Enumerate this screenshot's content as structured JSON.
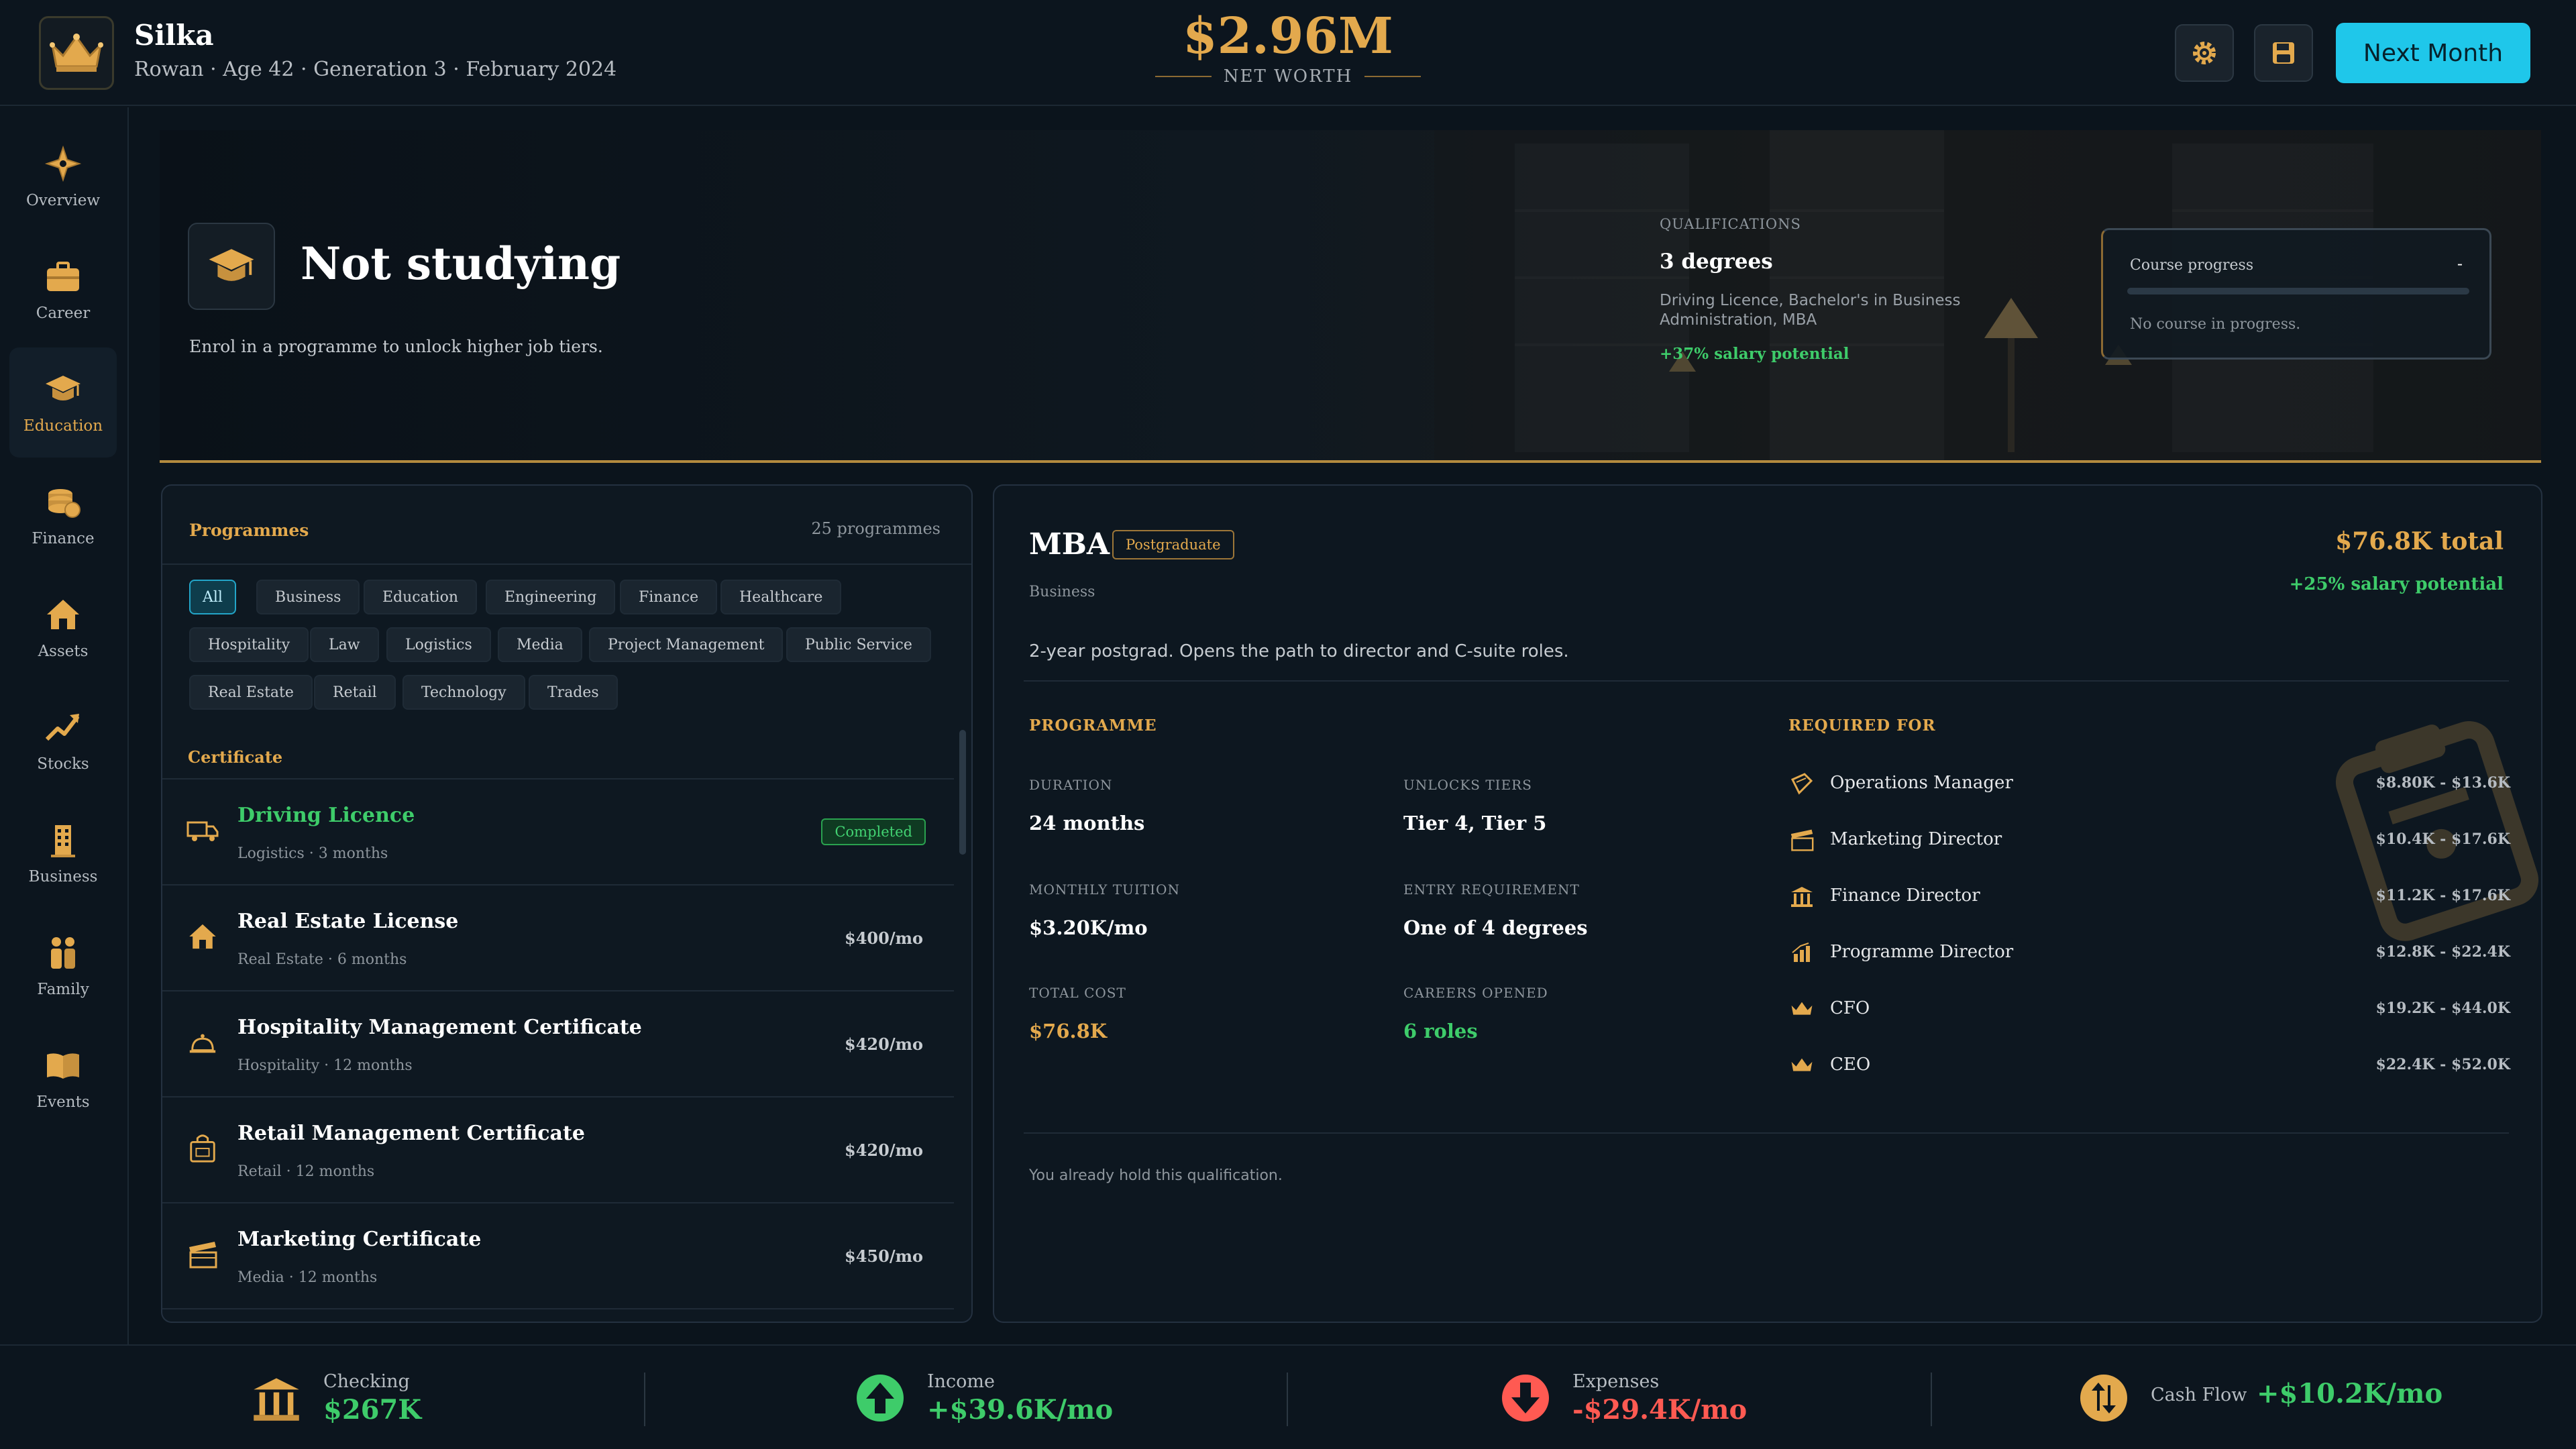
{
  "header": {
    "title": "Silka",
    "subtitle": "Rowan · Age 42 · Generation 3 · February 2024",
    "net_worth_value": "$2.96M",
    "net_worth_label": "NET WORTH",
    "next_month_label": "Next Month"
  },
  "sidebar": {
    "items": [
      {
        "label": "Overview",
        "icon": "compass-icon"
      },
      {
        "label": "Career",
        "icon": "briefcase-icon"
      },
      {
        "label": "Education",
        "icon": "graduation-cap-icon",
        "active": true
      },
      {
        "label": "Finance",
        "icon": "coins-icon"
      },
      {
        "label": "Assets",
        "icon": "house-icon"
      },
      {
        "label": "Stocks",
        "icon": "trend-arrow-icon"
      },
      {
        "label": "Business",
        "icon": "building-icon"
      },
      {
        "label": "Family",
        "icon": "family-icon"
      },
      {
        "label": "Events",
        "icon": "book-icon"
      }
    ]
  },
  "hero": {
    "title": "Not studying",
    "subtitle": "Enrol in a programme to unlock higher job tiers.",
    "qualifications_label": "QUALIFICATIONS",
    "qualifications_count": "3 degrees",
    "qualifications_list": "Driving Licence, Bachelor's in Business Administration, MBA",
    "salary_bonus": "+37% salary potential",
    "course_progress_label": "Course progress",
    "course_progress_value": "-",
    "course_progress_fraction": 0,
    "course_progress_note": "No course in progress."
  },
  "programmes": {
    "header": "Programmes",
    "count": "25 programmes",
    "filters": [
      "All",
      "Business",
      "Education",
      "Engineering",
      "Finance",
      "Healthcare",
      "Hospitality",
      "Law",
      "Logistics",
      "Media",
      "Project Management",
      "Public Service",
      "Real Estate",
      "Retail",
      "Technology",
      "Trades"
    ],
    "active_filter": "All",
    "group_label": "Certificate",
    "completed_label": "Completed",
    "items": [
      {
        "title": "Driving Licence",
        "meta": "Logistics · 3 months",
        "price": "",
        "completed": true,
        "icon": "truck-icon"
      },
      {
        "title": "Real Estate License",
        "meta": "Real Estate · 6 months",
        "price": "$400/mo",
        "completed": false,
        "icon": "house-icon"
      },
      {
        "title": "Hospitality Management Certificate",
        "meta": "Hospitality · 12 months",
        "price": "$420/mo",
        "completed": false,
        "icon": "service-bell-icon"
      },
      {
        "title": "Retail Management Certificate",
        "meta": "Retail · 12 months",
        "price": "$420/mo",
        "completed": false,
        "icon": "shopping-bag-icon"
      },
      {
        "title": "Marketing Certificate",
        "meta": "Media · 12 months",
        "price": "$450/mo",
        "completed": false,
        "icon": "clapperboard-icon"
      }
    ]
  },
  "detail": {
    "title": "MBA",
    "tag": "Postgraduate",
    "category": "Business",
    "total": "$76.8K total",
    "salary_bonus": "+25% salary potential",
    "description": "2-year postgrad. Opens the path to director and C-suite roles.",
    "programme_label": "PROGRAMME",
    "required_label": "REQUIRED FOR",
    "stats": {
      "duration_label": "DURATION",
      "duration_value": "24 months",
      "tiers_label": "UNLOCKS TIERS",
      "tiers_value": "Tier 4, Tier 5",
      "tuition_label": "MONTHLY TUITION",
      "tuition_value": "$3.20K/mo",
      "entry_label": "ENTRY REQUIREMENT",
      "entry_value": "One of 4 degrees",
      "cost_label": "TOTAL COST",
      "cost_value": "$76.8K",
      "careers_label": "CAREERS OPENED",
      "careers_value": "6 roles"
    },
    "required_for": [
      {
        "title": "Operations Manager",
        "range": "$8.80K - $13.6K",
        "icon": "package-icon"
      },
      {
        "title": "Marketing Director",
        "range": "$10.4K - $17.6K",
        "icon": "clapperboard-icon"
      },
      {
        "title": "Finance Director",
        "range": "$11.2K - $17.6K",
        "icon": "bank-icon"
      },
      {
        "title": "Programme Director",
        "range": "$12.8K - $22.4K",
        "icon": "chart-icon"
      },
      {
        "title": "CFO",
        "range": "$19.2K - $44.0K",
        "icon": "crown-icon"
      },
      {
        "title": "CEO",
        "range": "$22.4K - $52.0K",
        "icon": "crown-icon"
      }
    ],
    "note": "You already hold this qualification."
  },
  "footer": {
    "checking_label": "Checking",
    "checking_value": "$267K",
    "income_label": "Income",
    "income_value": "+$39.6K/mo",
    "expenses_label": "Expenses",
    "expenses_value": "-$29.4K/mo",
    "cashflow_label": "Cash Flow",
    "cashflow_value": "+$10.2K/mo"
  },
  "colors": {
    "accent_gold": "#e3a94d",
    "accent_cyan": "#1fc7ea",
    "positive": "#3ecc6a",
    "negative": "#ff5a52",
    "background": "#0b141c"
  }
}
